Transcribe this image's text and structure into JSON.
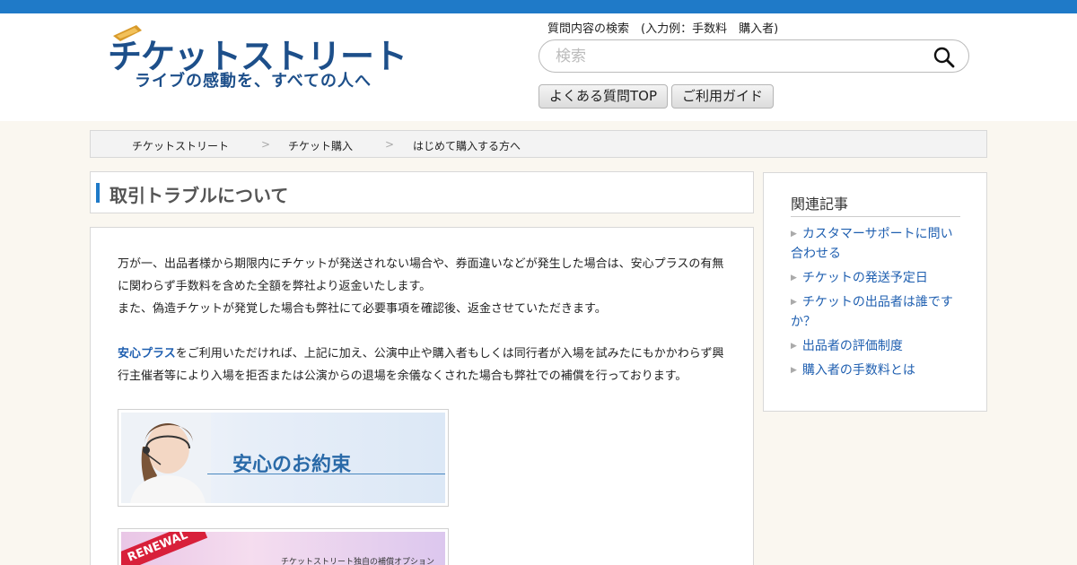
{
  "header": {
    "logo_text": "チケットストリート",
    "logo_tagline": "ライブの感動を、すべての人へ",
    "search_label": "質問内容の検索　(入力例：手数料　購入者)",
    "search_placeholder": "検索",
    "buttons": [
      "よくある質問TOP",
      "ご利用ガイド"
    ]
  },
  "breadcrumb": {
    "items": [
      "チケットストリート",
      "チケット購入",
      "はじめて購入する方へ"
    ],
    "separator": ">"
  },
  "article": {
    "title": "取引トラブルについて",
    "para1_line1": "万が一、出品者様から期限内にチケットが発送されない場合や、券面違いなどが発生した場合は、安心プラスの有無",
    "para1_line2": "に関わらず手数料を含めた全額を弊社より返金いたします。",
    "para1_line3": "また、偽造チケットが発覚した場合も弊社にて必要事項を確認後、返金させていただきます。",
    "para2_link": "安心プラス",
    "para2_rest_line1": "をご利用いただければ、上記に加え、公演中止や購入者もしくは同行者が入場を試みたにもかかわらず興",
    "para2_line2": "行主催者等により入場を拒否または公演からの退場を余儀なくされた場合も弊社での補償を行っております。",
    "banner1_text": "安心のお約束",
    "banner2_badge": "RENEWAL",
    "banner2_text": "チケットストリート独自の補償オプション"
  },
  "sidebar": {
    "title": "関連記事",
    "links": [
      "カスタマーサポートに問い合わせる",
      "チケットの発送予定日",
      "チケットの出品者は誰ですか？",
      "出品者の評価制度",
      "購入者の手数料とは"
    ]
  },
  "colors": {
    "accent": "#1f7ac8",
    "logo": "#1d4f8a",
    "link": "#1f5fb0"
  }
}
